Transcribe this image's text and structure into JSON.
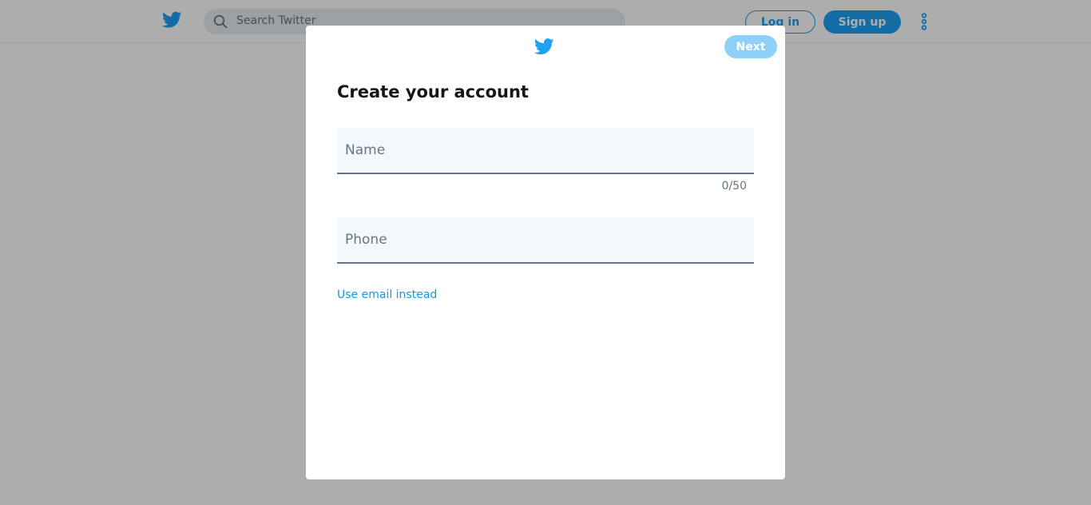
{
  "header": {
    "logo_icon": "twitter-bird-icon",
    "search": {
      "placeholder": "Search Twitter",
      "value": ""
    },
    "login_label": "Log in",
    "signup_label": "Sign up",
    "more_icon": "more-vertical-icon"
  },
  "modal": {
    "logo_icon": "twitter-bird-icon",
    "next_label": "Next",
    "title": "Create your account",
    "name_field": {
      "placeholder": "Name",
      "value": "",
      "counter": "0/50"
    },
    "phone_field": {
      "placeholder": "Phone",
      "value": ""
    },
    "use_email_label": "Use email instead"
  },
  "colors": {
    "brand": "#1da1f2",
    "next_disabled": "#8ed0f9",
    "link": "#1b95e0",
    "field_bg": "#f5f8fa",
    "muted_text": "#657786"
  }
}
